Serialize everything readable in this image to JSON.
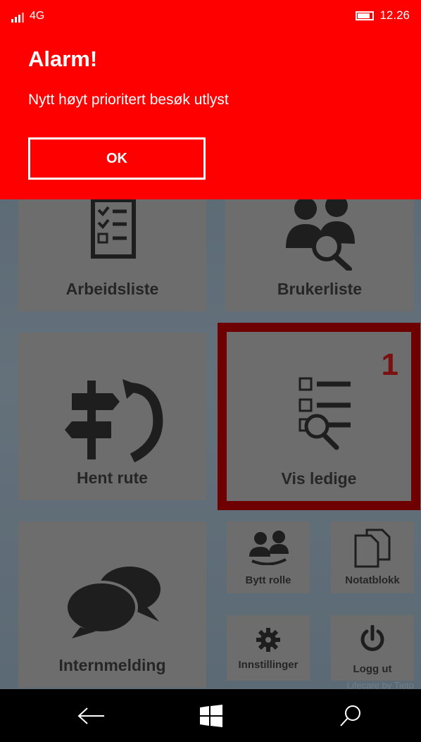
{
  "status_bar": {
    "signal_label": "4G",
    "time": "12.26"
  },
  "alarm": {
    "title": "Alarm!",
    "message": "Nytt høyt prioritert besøk utlyst",
    "ok_label": "OK",
    "background_color": "#ff0000"
  },
  "tiles": {
    "arbeidsliste": {
      "label": "Arbeidsliste",
      "icon": "checklist-icon"
    },
    "brukerliste": {
      "label": "Brukerliste",
      "icon": "users-search-icon"
    },
    "hent_rute": {
      "label": "Hent rute",
      "icon": "signpost-icon"
    },
    "vis_ledige": {
      "label": "Vis ledige",
      "icon": "list-search-icon",
      "badge": "1"
    },
    "internmelding": {
      "label": "Internmelding",
      "icon": "chat-bubbles-icon"
    },
    "bytt_rolle": {
      "label": "Bytt rolle",
      "icon": "swap-users-icon"
    },
    "notatblokk": {
      "label": "Notatblokk",
      "icon": "documents-icon"
    },
    "innstillinger": {
      "label": "Innstillinger",
      "icon": "gear-icon"
    },
    "logg_ut": {
      "label": "Logg ut",
      "icon": "power-icon"
    }
  },
  "footer_watermark": "Lifecare by Tieto",
  "nav": {
    "back": "back-arrow-icon",
    "home": "windows-logo-icon",
    "search": "search-icon"
  }
}
